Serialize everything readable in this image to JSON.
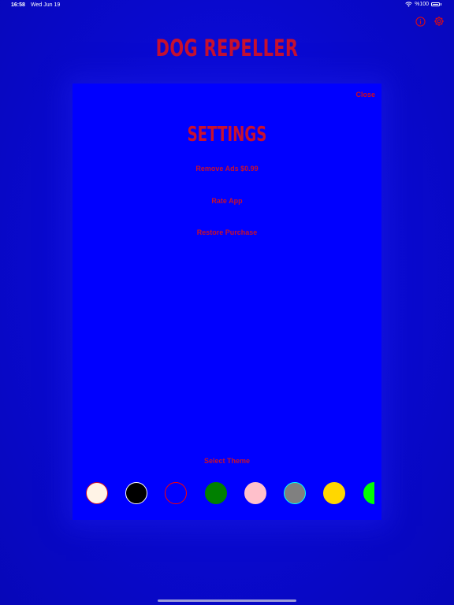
{
  "status_bar": {
    "time": "16:58",
    "date": "Wed Jun 19",
    "battery_text": "%100"
  },
  "header": {
    "title": "DOG REPELLER",
    "info_icon": "info-icon",
    "settings_icon": "gear-icon"
  },
  "settings": {
    "close_label": "Close",
    "title": "SETTINGS",
    "menu": [
      {
        "label": "Remove Ads $0.99"
      },
      {
        "label": "Rate App"
      },
      {
        "label": "Restore Purchase"
      }
    ],
    "theme_label": "Select Theme",
    "themes": [
      {
        "name": "cream",
        "color": "#fff3e6",
        "border": "#c8102e"
      },
      {
        "name": "black",
        "color": "#000000",
        "border": "#ffffff"
      },
      {
        "name": "blue",
        "color": "#0000ff",
        "border": "#ff0000"
      },
      {
        "name": "green",
        "color": "#008000",
        "border": "#008000"
      },
      {
        "name": "pink",
        "color": "#ffc0cb",
        "border": "#ffc0cb"
      },
      {
        "name": "gray",
        "color": "#808080",
        "border": "#00ffff"
      },
      {
        "name": "gold",
        "color": "#ffd700",
        "border": "#ffd700"
      },
      {
        "name": "lime",
        "color": "#00ff00",
        "border": "#00ff00"
      }
    ]
  },
  "colors": {
    "accent": "#c8102e",
    "panel": "#0000ff",
    "background": "#0a0ad0"
  }
}
